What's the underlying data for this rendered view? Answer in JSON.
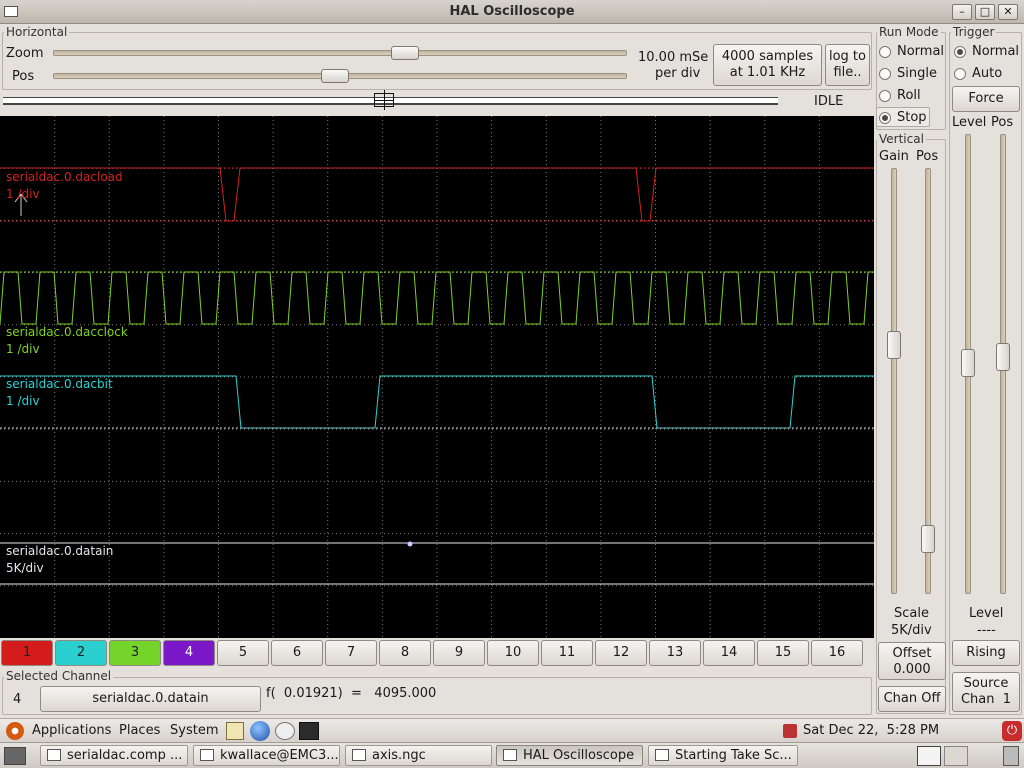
{
  "window": {
    "title": "HAL Oscilloscope"
  },
  "horizontal": {
    "frame_label": "Horizontal",
    "zoom_label": "Zoom",
    "pos_label": "Pos",
    "zoom_level": 0.62,
    "pos_level": 0.49,
    "scale_line1": "10.00 mSe",
    "scale_line2": "per div",
    "samples_line1": "4000 samples",
    "samples_line2": "at 1.01 KHz",
    "log_line1": "log to",
    "log_line2": "file..",
    "state": "IDLE"
  },
  "run_mode": {
    "label": "Run Mode",
    "options": [
      "Normal",
      "Single",
      "Roll",
      "Stop"
    ],
    "selected": "Stop"
  },
  "trigger": {
    "label": "Trigger",
    "options": [
      "Normal",
      "Auto"
    ],
    "selected": "Normal",
    "force_label": "Force",
    "level_label": "Level",
    "pos_label": "Pos",
    "level_title": "Level",
    "level_value": "----",
    "edge_button": "Rising",
    "source_line1": "Source",
    "source_line2": "Chan  1"
  },
  "vertical": {
    "label": "Vertical",
    "gain_label": "Gain",
    "pos_label": "Pos",
    "scale_title": "Scale",
    "scale_value": "5K/div",
    "offset_line1": "Offset",
    "offset_line2": "0.000",
    "chan_off_label": "Chan Off"
  },
  "traces": [
    {
      "name": "serialdac.0.dacload",
      "scale": "1 /div",
      "color": "#d42020"
    },
    {
      "name": "serialdac.0.dacclock",
      "scale": "1 /div",
      "color": "#7ed321"
    },
    {
      "name": "serialdac.0.dacbit",
      "scale": "1 /div",
      "color": "#28d4d4"
    },
    {
      "name": "serialdac.0.datain",
      "scale": "5K/div",
      "color": "#e6e6f0"
    }
  ],
  "channels": [
    {
      "label": "1",
      "color": "#d41c1c"
    },
    {
      "label": "2",
      "color": "#2ad0d0"
    },
    {
      "label": "3",
      "color": "#74d42a"
    },
    {
      "label": "4",
      "color": "#7a18c8"
    },
    {
      "label": "5"
    },
    {
      "label": "6"
    },
    {
      "label": "7"
    },
    {
      "label": "8"
    },
    {
      "label": "9"
    },
    {
      "label": "10"
    },
    {
      "label": "11"
    },
    {
      "label": "12"
    },
    {
      "label": "13"
    },
    {
      "label": "14"
    },
    {
      "label": "15"
    },
    {
      "label": "16"
    }
  ],
  "selected_channel": {
    "label": "Selected Channel",
    "number": "4",
    "signal_name": "serialdac.0.datain",
    "readout": "f(  0.01921)  =   4095.000"
  },
  "panel": {
    "menus": [
      "Applications",
      "Places",
      "System"
    ],
    "clock": "Sat Dec 22,  5:28 PM"
  },
  "taskbar": [
    {
      "label": "serialdac.comp ...",
      "active": false
    },
    {
      "label": "kwallace@EMC3...",
      "active": false
    },
    {
      "label": "axis.ngc",
      "active": false
    },
    {
      "label": "HAL Oscilloscope",
      "active": true
    },
    {
      "label": "Starting Take Sc...",
      "active": false
    }
  ]
}
